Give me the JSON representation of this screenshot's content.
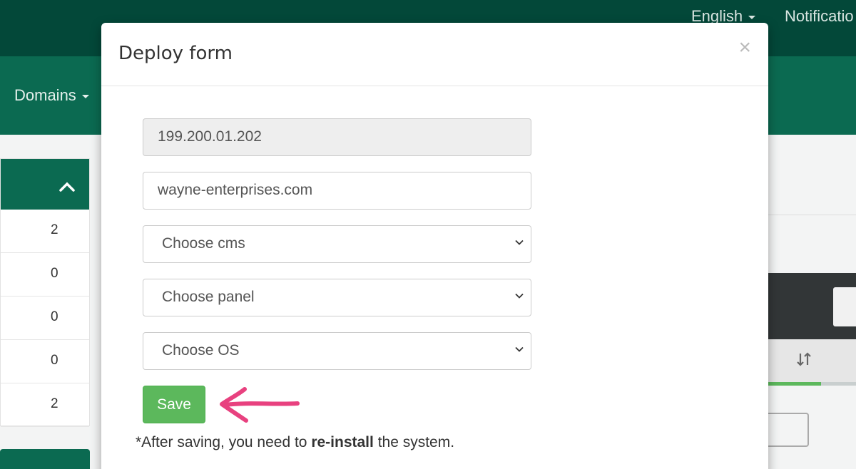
{
  "topbar": {
    "language": "English",
    "notifications": "Notificatio"
  },
  "navbar": {
    "domains": "Domains"
  },
  "leftpanel": {
    "rows": [
      "2",
      "0",
      "0",
      "0",
      "2"
    ]
  },
  "modal": {
    "title": "Deploy form",
    "close": "×",
    "ip_value": "199.200.01.202",
    "domain_value": "wayne-enterprises.com",
    "cms_select": "Choose cms",
    "panel_select": "Choose panel",
    "os_select": "Choose OS",
    "save_label": "Save",
    "note_prefix": "*After saving, you need to ",
    "note_bold": "re-install",
    "note_suffix": " the system."
  },
  "colors": {
    "topbar": "#034839",
    "navbar": "#0b6a51",
    "save": "#5cb85c",
    "arrow": "#e8417f"
  },
  "icons": [
    "caret-down-icon",
    "chevron-up-icon",
    "sort-icon",
    "chevron-down-icon",
    "close-icon",
    "arrow-left-icon"
  ]
}
